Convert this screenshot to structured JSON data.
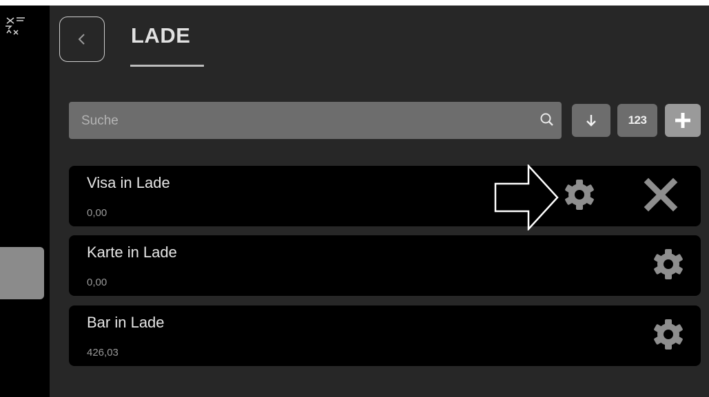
{
  "header": {
    "title": "LADE",
    "back_icon": "chevron-left-icon"
  },
  "search": {
    "placeholder": "Suche",
    "icon": "search-icon"
  },
  "toolbar": {
    "sort_icon": "arrow-down-icon",
    "numeric_label": "123",
    "add_icon": "plus-icon"
  },
  "items": [
    {
      "name": "Visa in Lade",
      "value": "0,00"
    },
    {
      "name": "Karte in Lade",
      "value": "0,00"
    },
    {
      "name": "Bar in Lade",
      "value": "426,03"
    }
  ],
  "colors": {
    "background": "#272727",
    "rail": "#000000",
    "item_bg": "#000000",
    "control_bg": "#6d6d6d",
    "icon": "#8e8e8e",
    "text": "#e6e6e6"
  }
}
